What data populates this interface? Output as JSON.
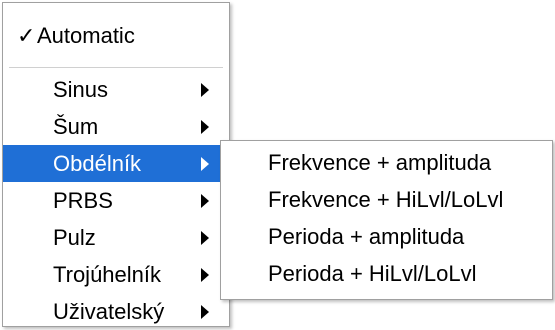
{
  "menu": {
    "automatic_label": "Automatic",
    "automatic_check": "✓",
    "items": [
      {
        "label": "Sinus"
      },
      {
        "label": "Šum"
      },
      {
        "label": "Obdélník"
      },
      {
        "label": "PRBS"
      },
      {
        "label": "Pulz"
      },
      {
        "label": "Trojúhelník"
      },
      {
        "label": "Uživatelský"
      }
    ],
    "highlight_color": "#1f6fd6"
  },
  "submenu": {
    "items": [
      {
        "label": "Frekvence + amplituda"
      },
      {
        "label": "Frekvence + HiLvl/LoLvl"
      },
      {
        "label": "Perioda + amplituda"
      },
      {
        "label": "Perioda + HiLvl/LoLvl"
      }
    ]
  }
}
